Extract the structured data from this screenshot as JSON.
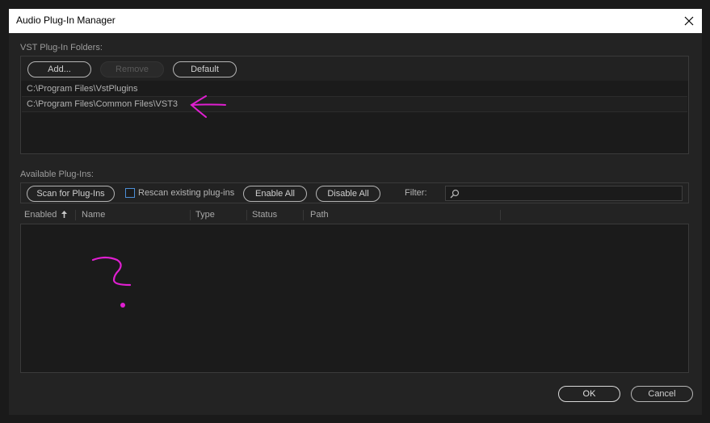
{
  "window": {
    "title": "Audio Plug-In Manager"
  },
  "vst_folders": {
    "label": "VST Plug-In Folders:",
    "buttons": {
      "add": "Add...",
      "remove": "Remove",
      "default": "Default"
    },
    "paths": [
      "C:\\Program Files\\VstPlugins",
      "C:\\Program Files\\Common Files\\VST3"
    ]
  },
  "available": {
    "label": "Available Plug-Ins:",
    "scan_button": "Scan for Plug-Ins",
    "rescan_label": "Rescan existing plug-ins",
    "rescan_checked": false,
    "enable_all": "Enable All",
    "disable_all": "Disable All",
    "filter_label": "Filter:",
    "filter_value": "",
    "columns": [
      "Enabled",
      "Name",
      "Type",
      "Status",
      "Path"
    ],
    "sort_icon": "sort-up-arrow-icon"
  },
  "footer": {
    "ok": "OK",
    "cancel": "Cancel"
  },
  "annotation_color": "#e01fd1",
  "accent_color": "#4d8fd6"
}
